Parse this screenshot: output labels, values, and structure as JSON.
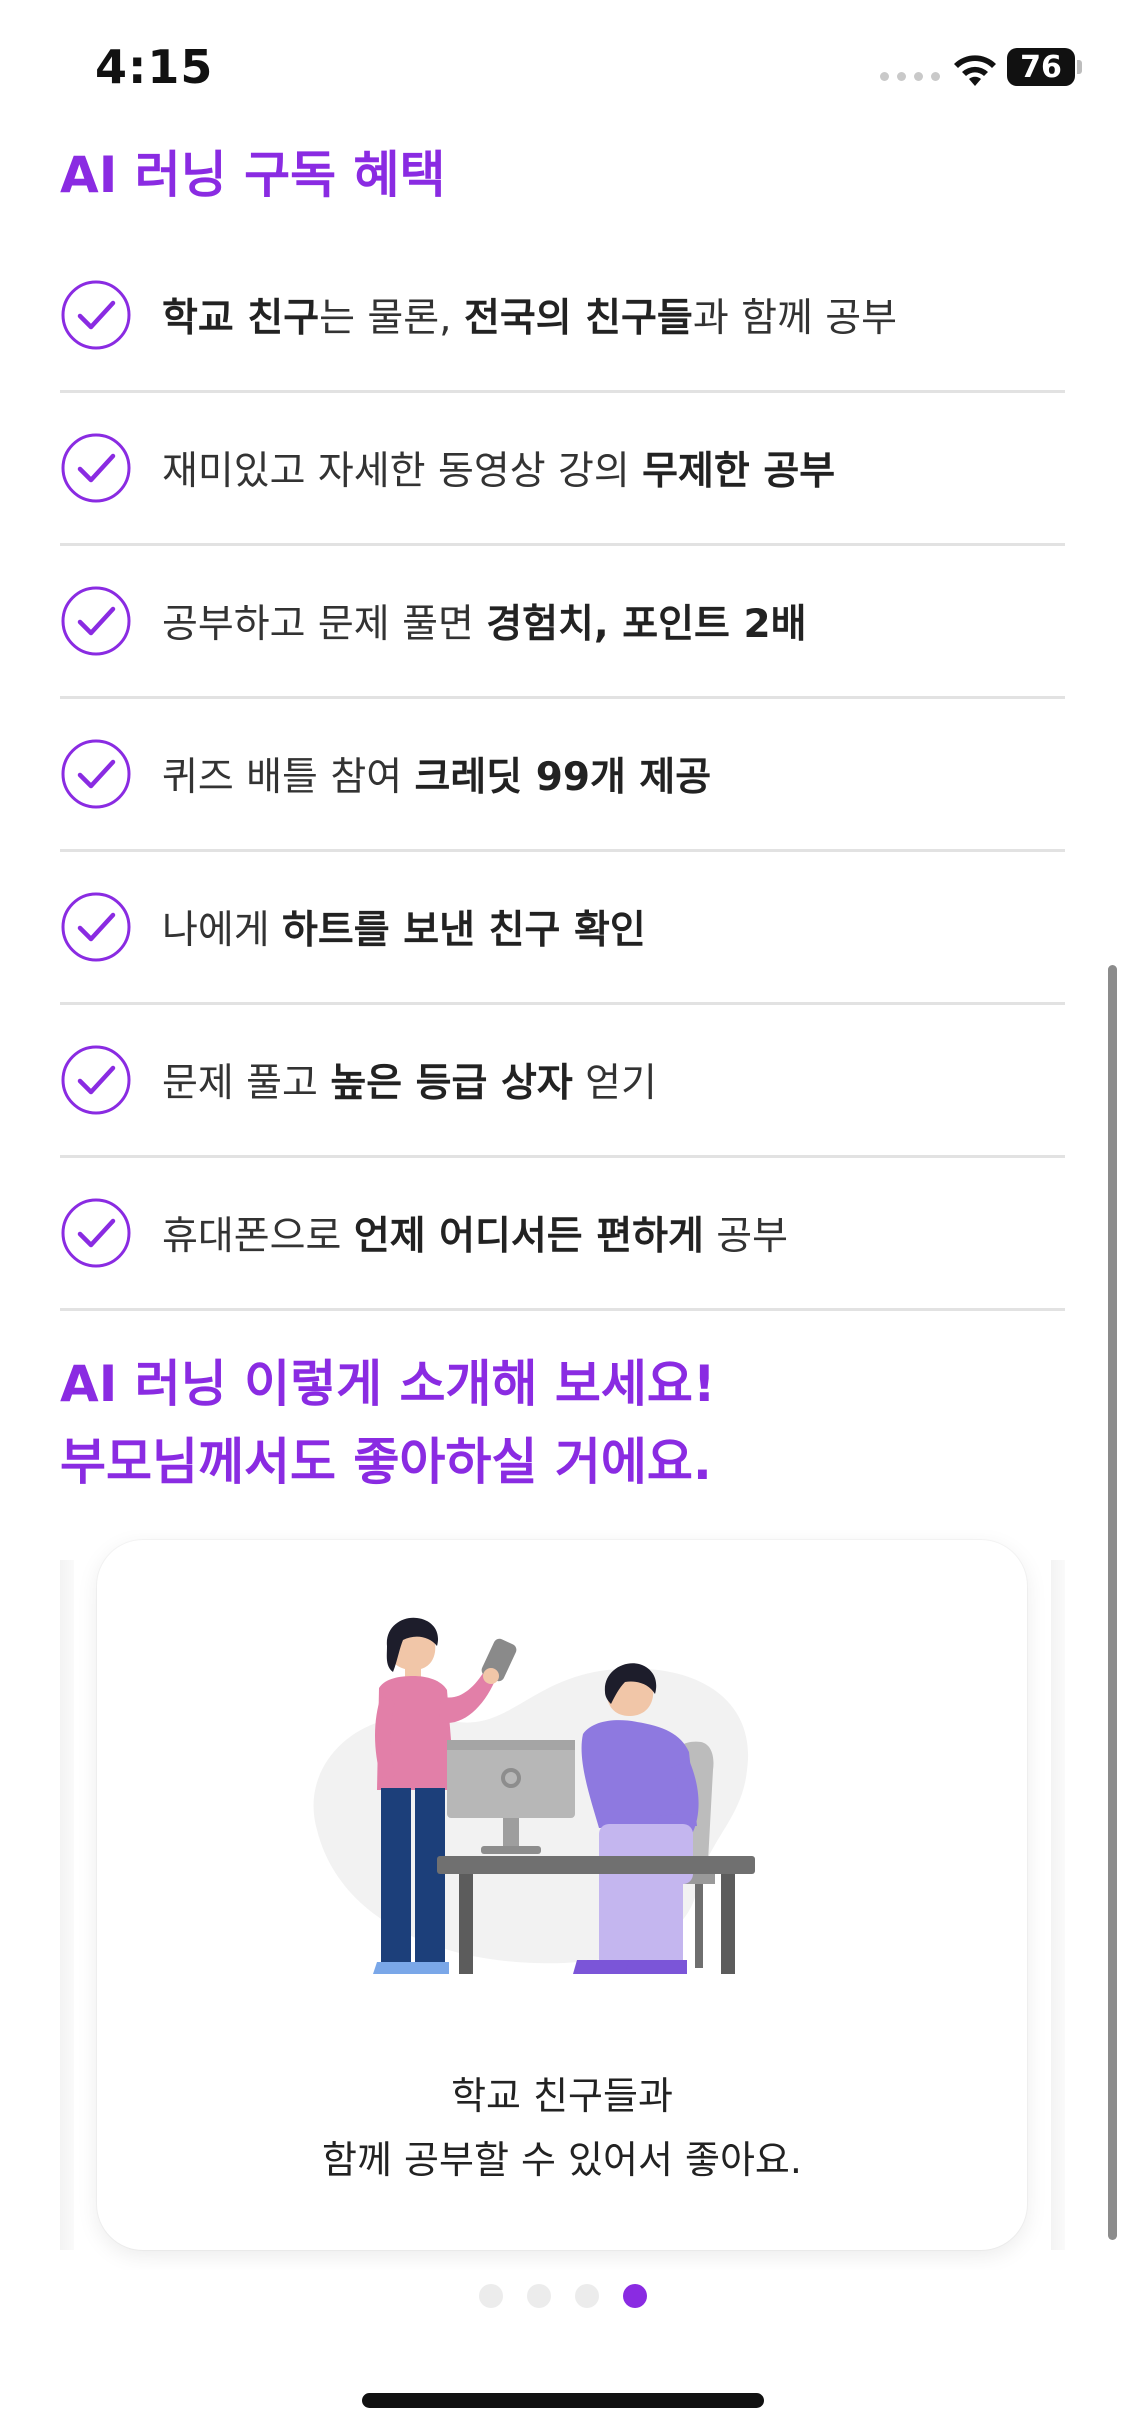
{
  "status_bar": {
    "time": "4:15",
    "battery": "76",
    "icons": [
      "cellular-signal-icon",
      "wifi-icon",
      "battery-icon"
    ]
  },
  "benefits": {
    "title": "AI 러닝 구독 혜택",
    "items": [
      {
        "parts": [
          {
            "text": "학교 친구",
            "bold": true
          },
          {
            "text": "는 물론, ",
            "bold": false
          },
          {
            "text": "전국의 친구들",
            "bold": true
          },
          {
            "text": "과 함께 공부",
            "bold": false
          }
        ]
      },
      {
        "parts": [
          {
            "text": "재미있고 자세한 동영상 강의 ",
            "bold": false
          },
          {
            "text": "무제한 공부",
            "bold": true
          }
        ]
      },
      {
        "parts": [
          {
            "text": "공부하고 문제 풀면 ",
            "bold": false
          },
          {
            "text": "경험치, 포인트 2배",
            "bold": true
          }
        ]
      },
      {
        "parts": [
          {
            "text": "퀴즈 배틀 참여 ",
            "bold": false
          },
          {
            "text": "크레딧 99개 제공",
            "bold": true
          }
        ]
      },
      {
        "parts": [
          {
            "text": "나에게 ",
            "bold": false
          },
          {
            "text": "하트를 보낸 친구 확인",
            "bold": true
          }
        ]
      },
      {
        "parts": [
          {
            "text": "문제 풀고 ",
            "bold": false
          },
          {
            "text": "높은 등급 상자",
            "bold": true
          },
          {
            "text": " 얻기",
            "bold": false
          }
        ]
      },
      {
        "parts": [
          {
            "text": "휴대폰으로 ",
            "bold": false
          },
          {
            "text": "언제 어디서든 편하게",
            "bold": true
          },
          {
            "text": " 공부",
            "bold": false
          }
        ]
      }
    ]
  },
  "intro": {
    "title_line1": "AI 러닝 이렇게 소개해 보세요!",
    "title_line2": "부모님께서도 좋아하실 거에요."
  },
  "carousel": {
    "caption_line1": "학교 친구들과",
    "caption_line2": "함께 공부할 수 있어서 좋아요.",
    "illustration": "two-people-studying-at-computer-illustration",
    "page_count": 4,
    "active_page": 4
  },
  "colors": {
    "accent": "#8a2be2",
    "text": "#222222",
    "divider": "#e2e2e2"
  }
}
